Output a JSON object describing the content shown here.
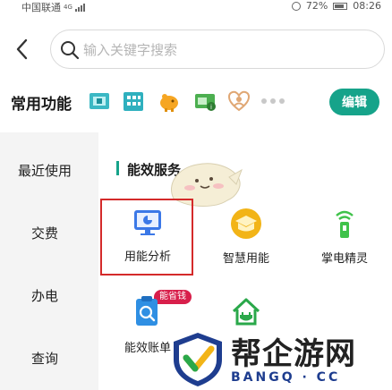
{
  "status_bar": {
    "carrier": "中国联通",
    "network": "4G",
    "battery": "72%",
    "time": "08:26"
  },
  "search": {
    "placeholder": "输入关键字搜索"
  },
  "common": {
    "title": "常用功能",
    "icons": [
      "bill-card-icon",
      "building-icon",
      "piggy-bank-icon",
      "ticket-icon",
      "heart-user-icon"
    ],
    "edit_label": "编辑"
  },
  "nav": {
    "items": [
      "最近使用",
      "交费",
      "办电",
      "查询"
    ]
  },
  "section": {
    "title": "能效服务"
  },
  "services": [
    {
      "label": "用能分析",
      "icon": "monitor-chart-icon"
    },
    {
      "label": "智慧用能",
      "icon": "smart-energy-icon"
    },
    {
      "label": "掌电精灵",
      "icon": "signal-tower-icon"
    },
    {
      "label": "能效账单",
      "icon": "bill-search-icon",
      "badge": "能省钱"
    },
    {
      "label": "",
      "icon": "house-plug-icon"
    }
  ],
  "watermark": {
    "cn": "帮企游网",
    "en": "BANGQ · CC"
  },
  "colors": {
    "accent": "#16a38a",
    "highlight": "#d42a2a",
    "badge": "#d81f4b"
  }
}
